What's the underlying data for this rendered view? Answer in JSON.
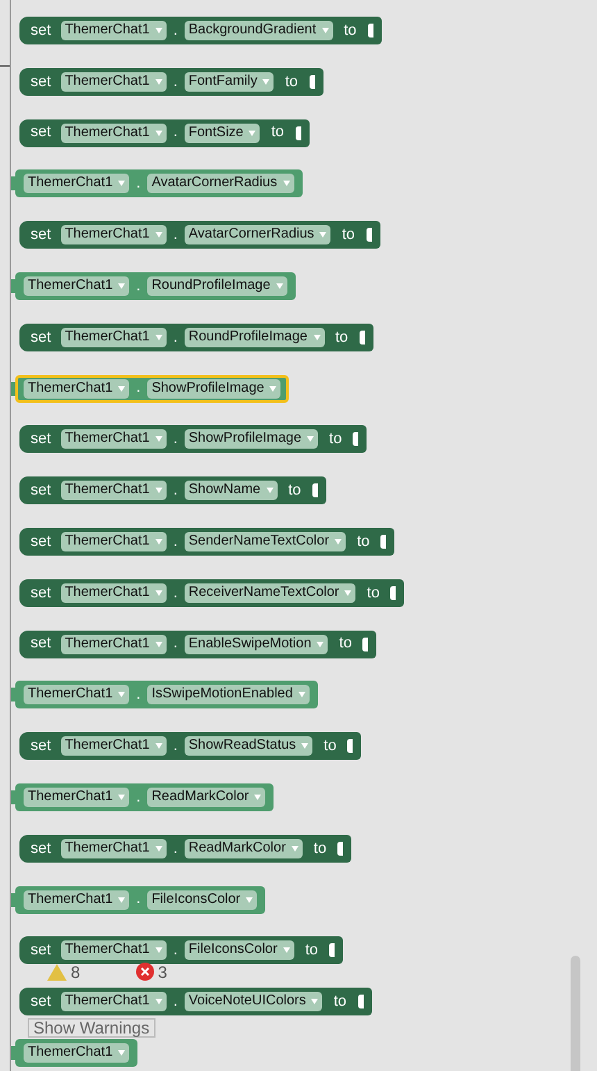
{
  "blocks": [
    {
      "kind": "setter",
      "separator": ".",
      "component": "ThemerChat1",
      "property": "BackgroundGradient",
      "set_label": "set",
      "to_label": "to",
      "selected": false
    },
    {
      "kind": "setter",
      "separator": ".",
      "component": "ThemerChat1",
      "property": "FontFamily",
      "set_label": "set",
      "to_label": "to",
      "selected": false
    },
    {
      "kind": "setter",
      "separator": ".",
      "component": "ThemerChat1",
      "property": "FontSize",
      "set_label": "set",
      "to_label": "to",
      "selected": false
    },
    {
      "kind": "getter",
      "separator": ".",
      "component": "ThemerChat1",
      "property": "AvatarCornerRadius",
      "selected": false
    },
    {
      "kind": "setter",
      "separator": ".",
      "component": "ThemerChat1",
      "property": "AvatarCornerRadius",
      "set_label": "set",
      "to_label": "to",
      "selected": false
    },
    {
      "kind": "getter",
      "separator": ".",
      "component": "ThemerChat1",
      "property": "RoundProfileImage",
      "selected": false
    },
    {
      "kind": "setter",
      "separator": ".",
      "component": "ThemerChat1",
      "property": "RoundProfileImage",
      "set_label": "set",
      "to_label": "to",
      "selected": false
    },
    {
      "kind": "getter",
      "separator": ".",
      "component": "ThemerChat1",
      "property": "ShowProfileImage",
      "selected": true
    },
    {
      "kind": "setter",
      "separator": ".",
      "component": "ThemerChat1",
      "property": "ShowProfileImage",
      "set_label": "set",
      "to_label": "to",
      "selected": false
    },
    {
      "kind": "setter",
      "separator": ".",
      "component": "ThemerChat1",
      "property": "ShowName",
      "set_label": "set",
      "to_label": "to",
      "selected": false
    },
    {
      "kind": "setter",
      "separator": ".",
      "component": "ThemerChat1",
      "property": "SenderNameTextColor",
      "set_label": "set",
      "to_label": "to",
      "selected": false
    },
    {
      "kind": "setter",
      "separator": ".",
      "component": "ThemerChat1",
      "property": "ReceiverNameTextColor",
      "set_label": "set",
      "to_label": "to",
      "selected": false
    },
    {
      "kind": "setter",
      "separator": ".",
      "component": "ThemerChat1",
      "property": "EnableSwipeMotion",
      "set_label": "set",
      "to_label": "to",
      "selected": false
    },
    {
      "kind": "getter",
      "separator": ".",
      "component": "ThemerChat1",
      "property": "IsSwipeMotionEnabled",
      "selected": false
    },
    {
      "kind": "setter",
      "separator": ".",
      "component": "ThemerChat1",
      "property": "ShowReadStatus",
      "set_label": "set",
      "to_label": "to",
      "selected": false
    },
    {
      "kind": "getter",
      "separator": ".",
      "component": "ThemerChat1",
      "property": "ReadMarkColor",
      "selected": false
    },
    {
      "kind": "setter",
      "separator": ".",
      "component": "ThemerChat1",
      "property": "ReadMarkColor",
      "set_label": "set",
      "to_label": "to",
      "selected": false
    },
    {
      "kind": "getter",
      "separator": ".",
      "component": "ThemerChat1",
      "property": "FileIconsColor",
      "selected": false
    },
    {
      "kind": "setter",
      "separator": ".",
      "component": "ThemerChat1",
      "property": "FileIconsColor",
      "set_label": "set",
      "to_label": "to",
      "selected": false
    },
    {
      "kind": "setter",
      "separator": ".",
      "component": "ThemerChat1",
      "property": "VoiceNoteUIColors",
      "set_label": "set",
      "to_label": "to",
      "selected": false
    },
    {
      "kind": "component",
      "component": "ThemerChat1",
      "selected": false
    }
  ],
  "warnings": {
    "warning_count": "8",
    "error_count": "3",
    "button": "Show Warnings"
  }
}
